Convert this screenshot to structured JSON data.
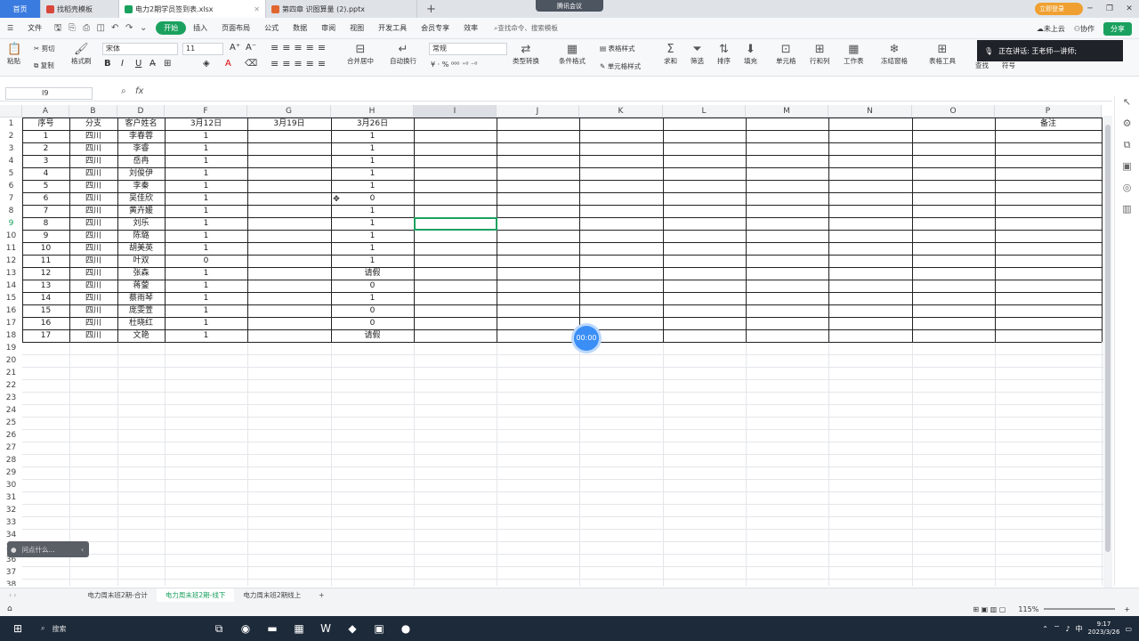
{
  "tabs": [
    {
      "label": "首页",
      "type": "home"
    },
    {
      "label": "找稻壳模板",
      "color": "#d9473c"
    },
    {
      "label": "电力2期学员签到表.xlsx",
      "color": "#1aa15f",
      "active": true
    },
    {
      "label": "第四章  识图算量 (2).pptx",
      "color": "#e0652f"
    }
  ],
  "meeting": "腾讯会议",
  "login_btn": "立即登录",
  "menus": [
    "文件",
    "开始",
    "插入",
    "页面布局",
    "公式",
    "数据",
    "审阅",
    "视图",
    "开发工具",
    "会员专享",
    "效率"
  ],
  "menu_active": "开始",
  "search_cmd": "查找命令、搜索模板",
  "right_menu": {
    "cloud": "未上云",
    "collab": "协作",
    "share": "分享"
  },
  "ribbon": {
    "paste": "粘贴",
    "cut": "剪切",
    "copy": "复制",
    "format_painter": "格式刷",
    "font": "宋体",
    "size": "11",
    "merge": "合并居中",
    "wrap": "自动换行",
    "number_format": "常规",
    "type_convert": "类型转换",
    "cond_format": "条件格式",
    "table_style": "表格样式",
    "cell_style": "单元格样式",
    "sum": "求和",
    "filter": "筛选",
    "sort": "排序",
    "fill": "填充",
    "cell": "单元格",
    "rowcol": "行和列",
    "worksheet": "工作表",
    "freeze": "冻结窗格",
    "table_tools": "表格工具",
    "find": "查找",
    "symbol": "符号"
  },
  "speaking": "正在讲话: 王老师—讲师;",
  "namebox": "I9",
  "fx": "fx",
  "columns": [
    "A",
    "B",
    "D",
    "F",
    "G",
    "H",
    "I",
    "J",
    "K",
    "L",
    "M",
    "N",
    "O",
    "P"
  ],
  "header_row": {
    "A": "序号",
    "B": "分支",
    "D": "客户姓名",
    "F": "3月12日",
    "G": "3月19日",
    "H": "3月26日",
    "P": "备注"
  },
  "rows": [
    {
      "A": "1",
      "B": "四川",
      "D": "李春蓉",
      "F": "1",
      "H": "1"
    },
    {
      "A": "2",
      "B": "四川",
      "D": "李睿",
      "F": "1",
      "H": "1"
    },
    {
      "A": "3",
      "B": "四川",
      "D": "岳冉",
      "F": "1",
      "H": "1"
    },
    {
      "A": "4",
      "B": "四川",
      "D": "刘俊伊",
      "F": "1",
      "H": "1"
    },
    {
      "A": "5",
      "B": "四川",
      "D": "李秦",
      "F": "1",
      "H": "1"
    },
    {
      "A": "6",
      "B": "四川",
      "D": "吴佳欣",
      "F": "1",
      "H": "0"
    },
    {
      "A": "7",
      "B": "四川",
      "D": "黄卉媛",
      "F": "1",
      "H": "1"
    },
    {
      "A": "8",
      "B": "四川",
      "D": "刘乐",
      "F": "1",
      "H": "1"
    },
    {
      "A": "9",
      "B": "四川",
      "D": "陈璐",
      "F": "1",
      "H": "1"
    },
    {
      "A": "10",
      "B": "四川",
      "D": "胡美英",
      "F": "1",
      "H": "1"
    },
    {
      "A": "11",
      "B": "四川",
      "D": "叶双",
      "F": "0",
      "H": "1"
    },
    {
      "A": "12",
      "B": "四川",
      "D": "张森",
      "F": "1",
      "H": "请假"
    },
    {
      "A": "13",
      "B": "四川",
      "D": "蒋蓥",
      "F": "1",
      "H": "0"
    },
    {
      "A": "14",
      "B": "四川",
      "D": "蔡雨琴",
      "F": "1",
      "H": "1"
    },
    {
      "A": "15",
      "B": "四川",
      "D": "庞雯萱",
      "F": "1",
      "H": "0"
    },
    {
      "A": "16",
      "B": "四川",
      "D": "杜晓红",
      "F": "1",
      "H": "0"
    },
    {
      "A": "17",
      "B": "四川",
      "D": "文艳",
      "F": "1",
      "H": "请假"
    }
  ],
  "row_count": 38,
  "timer": "00:00",
  "ask": "问点什么...",
  "sheets": [
    "电力周末班2期-合计",
    "电力周末班2期-线下",
    "电力周末班2期线上"
  ],
  "active_sheet": "电力周末班2期-线下",
  "zoom": "115%",
  "taskbar": {
    "search": "搜索",
    "time": "9:17",
    "date": "2023/3/26",
    "ime": "中"
  }
}
